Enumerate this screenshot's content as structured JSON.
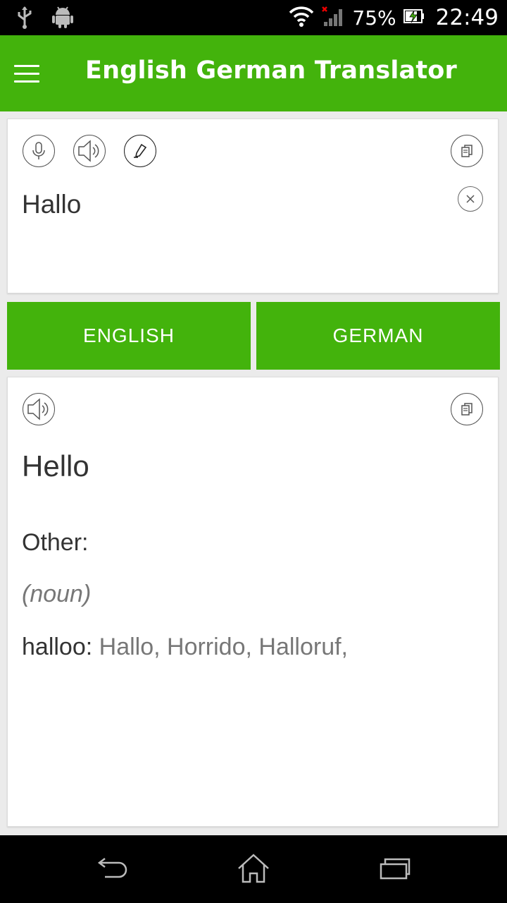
{
  "status_bar": {
    "battery_percent": "75%",
    "time": "22:49"
  },
  "app_bar": {
    "title": "English German Translator"
  },
  "input": {
    "text": "Hallo"
  },
  "languages": {
    "source": "ENGLISH",
    "target": "GERMAN"
  },
  "output": {
    "translation": "Hello",
    "other_label": "Other:",
    "part_of_speech": "(noun)",
    "entries": [
      {
        "word": "halloo:",
        "translations": " Hallo, Horrido, Halloruf,"
      }
    ]
  },
  "colors": {
    "accent": "#43b30c",
    "background": "#ebebeb"
  }
}
